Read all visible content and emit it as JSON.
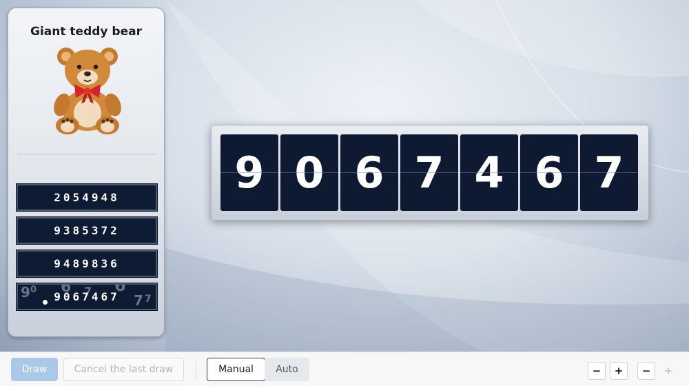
{
  "prize": {
    "title": "Giant teddy bear",
    "image_icon": "teddy-bear-icon"
  },
  "current_draw": {
    "digits": [
      "9",
      "0",
      "6",
      "7",
      "4",
      "6",
      "7"
    ]
  },
  "history": [
    {
      "value": "2054948"
    },
    {
      "value": "9385372"
    },
    {
      "value": "9489836"
    },
    {
      "value": "9067467"
    }
  ],
  "toolbar": {
    "draw_label": "Draw",
    "cancel_label": "Cancel the last draw",
    "mode_manual_label": "Manual",
    "mode_auto_label": "Auto",
    "selected_mode": "Manual",
    "zoom_out_1": "−",
    "zoom_in_1": "+",
    "zoom_out_2": "−",
    "zoom_in_2": "+"
  },
  "colors": {
    "digit_bg": "#0d1a31",
    "draw_button": "#a9c8ea",
    "ribbon": "#d8232a",
    "bear_fur": "#d08a3a"
  }
}
